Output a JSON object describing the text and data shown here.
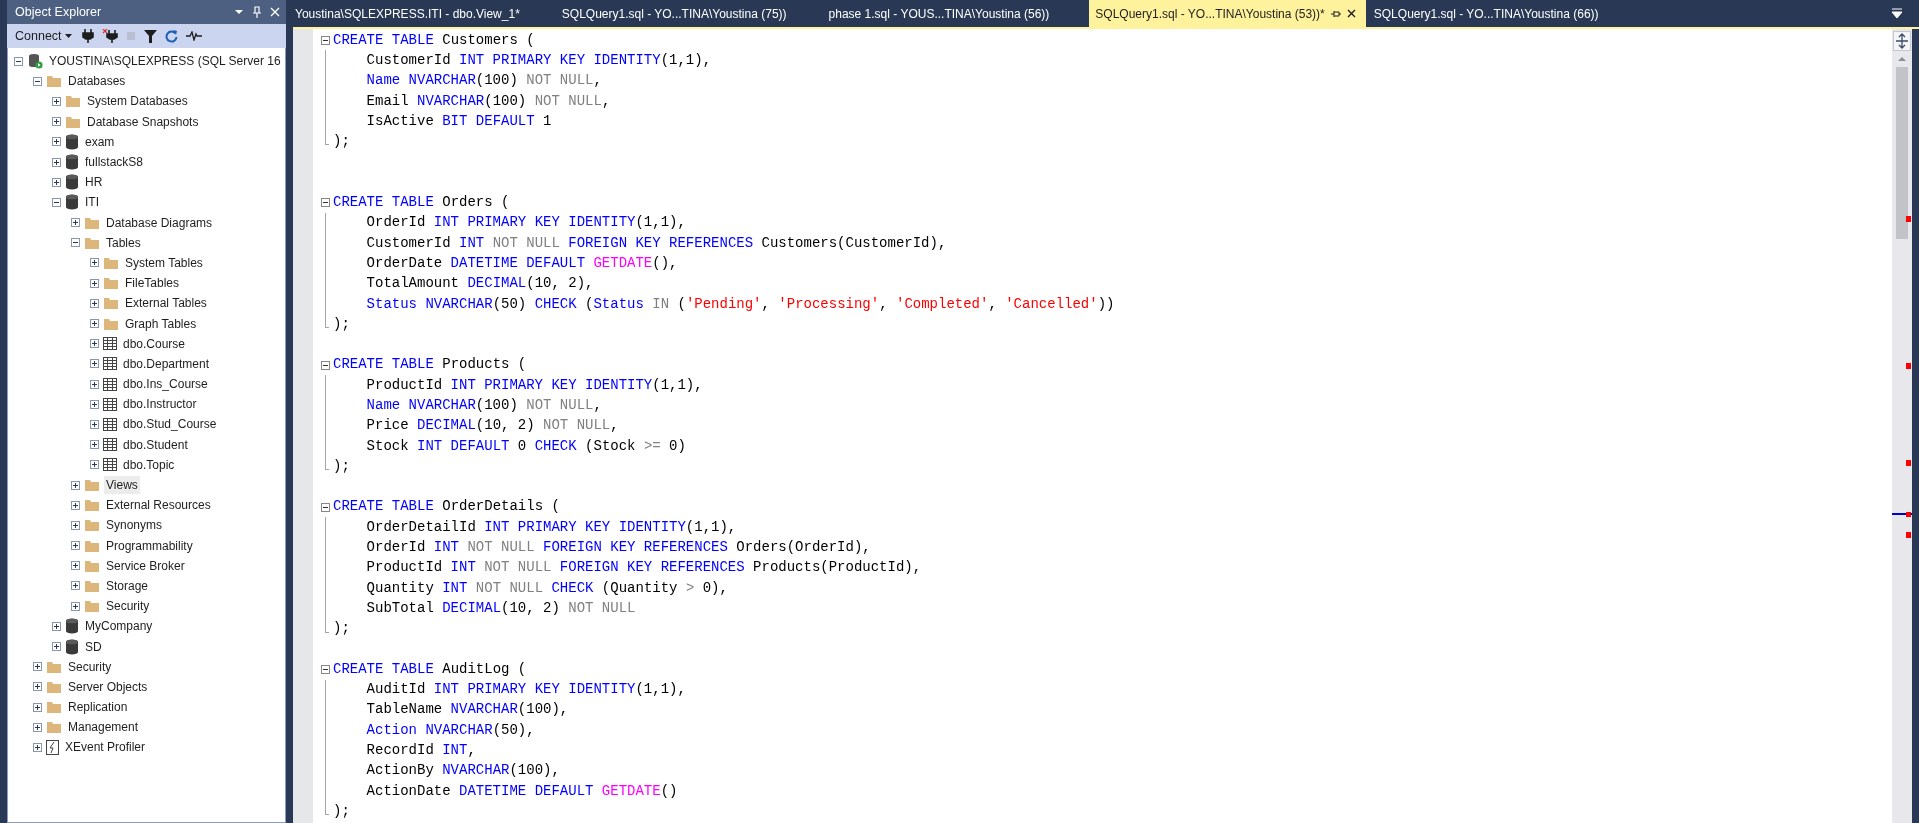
{
  "object_explorer": {
    "title": "Object Explorer",
    "toolbar": {
      "connect_label": "Connect"
    },
    "tree": [
      {
        "label": "YOUSTINA\\SQLEXPRESS (SQL Server 16",
        "kind": "server",
        "expanded": true,
        "selected": false,
        "children": [
          {
            "label": "Databases",
            "kind": "folder",
            "expanded": true,
            "selected": false,
            "children": [
              {
                "label": "System Databases",
                "kind": "folder",
                "expanded": false,
                "selected": false
              },
              {
                "label": "Database Snapshots",
                "kind": "folder",
                "expanded": false,
                "selected": false
              },
              {
                "label": "exam",
                "kind": "database",
                "expanded": false,
                "selected": false
              },
              {
                "label": "fullstackS8",
                "kind": "database",
                "expanded": false,
                "selected": false
              },
              {
                "label": "HR",
                "kind": "database",
                "expanded": false,
                "selected": false
              },
              {
                "label": "ITI",
                "kind": "database",
                "expanded": true,
                "selected": false,
                "children": [
                  {
                    "label": "Database Diagrams",
                    "kind": "folder",
                    "expanded": false,
                    "selected": false
                  },
                  {
                    "label": "Tables",
                    "kind": "folder",
                    "expanded": true,
                    "selected": false,
                    "children": [
                      {
                        "label": "System Tables",
                        "kind": "folder",
                        "expanded": false,
                        "selected": false
                      },
                      {
                        "label": "FileTables",
                        "kind": "folder",
                        "expanded": false,
                        "selected": false
                      },
                      {
                        "label": "External Tables",
                        "kind": "folder",
                        "expanded": false,
                        "selected": false
                      },
                      {
                        "label": "Graph Tables",
                        "kind": "folder",
                        "expanded": false,
                        "selected": false
                      },
                      {
                        "label": "dbo.Course",
                        "kind": "table",
                        "expanded": false,
                        "selected": false
                      },
                      {
                        "label": "dbo.Department",
                        "kind": "table",
                        "expanded": false,
                        "selected": false
                      },
                      {
                        "label": "dbo.Ins_Course",
                        "kind": "table",
                        "expanded": false,
                        "selected": false
                      },
                      {
                        "label": "dbo.Instructor",
                        "kind": "table",
                        "expanded": false,
                        "selected": false
                      },
                      {
                        "label": "dbo.Stud_Course",
                        "kind": "table",
                        "expanded": false,
                        "selected": false
                      },
                      {
                        "label": "dbo.Student",
                        "kind": "table",
                        "expanded": false,
                        "selected": false
                      },
                      {
                        "label": "dbo.Topic",
                        "kind": "table",
                        "expanded": false,
                        "selected": false
                      }
                    ]
                  },
                  {
                    "label": "Views",
                    "kind": "folder",
                    "expanded": false,
                    "selected": true
                  },
                  {
                    "label": "External Resources",
                    "kind": "folder",
                    "expanded": false,
                    "selected": false
                  },
                  {
                    "label": "Synonyms",
                    "kind": "folder",
                    "expanded": false,
                    "selected": false
                  },
                  {
                    "label": "Programmability",
                    "kind": "folder",
                    "expanded": false,
                    "selected": false
                  },
                  {
                    "label": "Service Broker",
                    "kind": "folder",
                    "expanded": false,
                    "selected": false
                  },
                  {
                    "label": "Storage",
                    "kind": "folder",
                    "expanded": false,
                    "selected": false
                  },
                  {
                    "label": "Security",
                    "kind": "folder",
                    "expanded": false,
                    "selected": false
                  }
                ]
              },
              {
                "label": "MyCompany",
                "kind": "database",
                "expanded": false,
                "selected": false
              },
              {
                "label": "SD",
                "kind": "database",
                "expanded": false,
                "selected": false
              }
            ]
          },
          {
            "label": "Security",
            "kind": "folder",
            "expanded": false,
            "selected": false
          },
          {
            "label": "Server Objects",
            "kind": "folder",
            "expanded": false,
            "selected": false
          },
          {
            "label": "Replication",
            "kind": "folder",
            "expanded": false,
            "selected": false
          },
          {
            "label": "Management",
            "kind": "folder",
            "expanded": false,
            "selected": false
          },
          {
            "label": "XEvent Profiler",
            "kind": "xevent",
            "expanded": false,
            "selected": false
          }
        ]
      }
    ]
  },
  "tabs": [
    {
      "label": "Youstina\\SQLEXPRESS.ITI - dbo.View_1*",
      "selected": false
    },
    {
      "label": "SQLQuery1.sql - YO...TINA\\Youstina (75))",
      "selected": false
    },
    {
      "label": "phase 1.sql - YOUS...TINA\\Youstina (56))",
      "selected": false
    },
    {
      "label": "SQLQuery1.sql - YO...TINA\\Youstina (53))*",
      "selected": true
    },
    {
      "label": "SQLQuery1.sql - YO...TINA\\Youstina (66))",
      "selected": false
    }
  ],
  "editor": {
    "lines": [
      {
        "kind": "block_start",
        "tokens": [
          {
            "kind": "keyword",
            "text": "CREATE TABLE"
          },
          {
            "kind": "plain",
            "text": " Customers ("
          }
        ]
      },
      {
        "kind": "body",
        "tokens": [
          {
            "kind": "plain",
            "text": "CustomerId "
          },
          {
            "kind": "keyword",
            "text": "INT PRIMARY KEY IDENTITY"
          },
          {
            "kind": "plain",
            "text": "(1,1),"
          }
        ]
      },
      {
        "kind": "body",
        "tokens": [
          {
            "kind": "keyword",
            "text": "Name NVARCHAR"
          },
          {
            "kind": "plain",
            "text": "(100) "
          },
          {
            "kind": "gray",
            "text": "NOT NULL"
          },
          {
            "kind": "plain",
            "text": ","
          }
        ]
      },
      {
        "kind": "body",
        "tokens": [
          {
            "kind": "plain",
            "text": "Email "
          },
          {
            "kind": "keyword",
            "text": "NVARCHAR"
          },
          {
            "kind": "plain",
            "text": "(100) "
          },
          {
            "kind": "gray",
            "text": "NOT NULL"
          },
          {
            "kind": "plain",
            "text": ","
          }
        ]
      },
      {
        "kind": "body",
        "tokens": [
          {
            "kind": "plain",
            "text": "IsActive "
          },
          {
            "kind": "keyword",
            "text": "BIT DEFAULT"
          },
          {
            "kind": "plain",
            "text": " 1"
          }
        ]
      },
      {
        "kind": "block_end",
        "tokens": [
          {
            "kind": "plain",
            "text": ");"
          }
        ]
      },
      {
        "kind": "blank"
      },
      {
        "kind": "blank"
      },
      {
        "kind": "block_start",
        "tokens": [
          {
            "kind": "keyword",
            "text": "CREATE TABLE"
          },
          {
            "kind": "plain",
            "text": " Orders ("
          }
        ]
      },
      {
        "kind": "body",
        "tokens": [
          {
            "kind": "plain",
            "text": "OrderId "
          },
          {
            "kind": "keyword",
            "text": "INT PRIMARY KEY IDENTITY"
          },
          {
            "kind": "plain",
            "text": "(1,1),"
          }
        ]
      },
      {
        "kind": "body",
        "tokens": [
          {
            "kind": "plain",
            "text": "CustomerId "
          },
          {
            "kind": "keyword",
            "text": "INT "
          },
          {
            "kind": "gray",
            "text": "NOT NULL "
          },
          {
            "kind": "keyword",
            "text": "FOREIGN KEY REFERENCES"
          },
          {
            "kind": "plain",
            "text": " Customers(CustomerId),"
          }
        ]
      },
      {
        "kind": "body",
        "tokens": [
          {
            "kind": "plain",
            "text": "OrderDate "
          },
          {
            "kind": "keyword",
            "text": "DATETIME DEFAULT "
          },
          {
            "kind": "function",
            "text": "GETDATE"
          },
          {
            "kind": "plain",
            "text": "(),"
          }
        ]
      },
      {
        "kind": "body",
        "tokens": [
          {
            "kind": "plain",
            "text": "TotalAmount "
          },
          {
            "kind": "keyword",
            "text": "DECIMAL"
          },
          {
            "kind": "plain",
            "text": "(10, 2),"
          }
        ]
      },
      {
        "kind": "body",
        "tokens": [
          {
            "kind": "keyword",
            "text": "Status NVARCHAR"
          },
          {
            "kind": "plain",
            "text": "(50) "
          },
          {
            "kind": "keyword",
            "text": "CHECK"
          },
          {
            "kind": "plain",
            "text": " ("
          },
          {
            "kind": "keyword",
            "text": "Status "
          },
          {
            "kind": "gray",
            "text": "IN"
          },
          {
            "kind": "plain",
            "text": " ("
          },
          {
            "kind": "string",
            "text": "'Pending'"
          },
          {
            "kind": "plain",
            "text": ", "
          },
          {
            "kind": "string",
            "text": "'Processing'"
          },
          {
            "kind": "plain",
            "text": ", "
          },
          {
            "kind": "string",
            "text": "'Completed'"
          },
          {
            "kind": "plain",
            "text": ", "
          },
          {
            "kind": "string",
            "text": "'Cancelled'"
          },
          {
            "kind": "plain",
            "text": "))"
          }
        ]
      },
      {
        "kind": "block_end",
        "tokens": [
          {
            "kind": "plain",
            "text": ");"
          }
        ]
      },
      {
        "kind": "blank"
      },
      {
        "kind": "block_start",
        "tokens": [
          {
            "kind": "keyword",
            "text": "CREATE TABLE"
          },
          {
            "kind": "plain",
            "text": " Products ("
          }
        ]
      },
      {
        "kind": "body",
        "tokens": [
          {
            "kind": "plain",
            "text": "ProductId "
          },
          {
            "kind": "keyword",
            "text": "INT PRIMARY KEY IDENTITY"
          },
          {
            "kind": "plain",
            "text": "(1,1),"
          }
        ]
      },
      {
        "kind": "body",
        "tokens": [
          {
            "kind": "keyword",
            "text": "Name NVARCHAR"
          },
          {
            "kind": "plain",
            "text": "(100) "
          },
          {
            "kind": "gray",
            "text": "NOT NULL"
          },
          {
            "kind": "plain",
            "text": ","
          }
        ]
      },
      {
        "kind": "body",
        "tokens": [
          {
            "kind": "plain",
            "text": "Price "
          },
          {
            "kind": "keyword",
            "text": "DECIMAL"
          },
          {
            "kind": "plain",
            "text": "(10, 2) "
          },
          {
            "kind": "gray",
            "text": "NOT NULL"
          },
          {
            "kind": "plain",
            "text": ","
          }
        ]
      },
      {
        "kind": "body",
        "tokens": [
          {
            "kind": "plain",
            "text": "Stock "
          },
          {
            "kind": "keyword",
            "text": "INT DEFAULT"
          },
          {
            "kind": "plain",
            "text": " 0 "
          },
          {
            "kind": "keyword",
            "text": "CHECK"
          },
          {
            "kind": "plain",
            "text": " (Stock "
          },
          {
            "kind": "gray",
            "text": ">="
          },
          {
            "kind": "plain",
            "text": " 0)"
          }
        ]
      },
      {
        "kind": "block_end",
        "tokens": [
          {
            "kind": "plain",
            "text": ");"
          }
        ]
      },
      {
        "kind": "blank"
      },
      {
        "kind": "block_start",
        "tokens": [
          {
            "kind": "keyword",
            "text": "CREATE TABLE"
          },
          {
            "kind": "plain",
            "text": " OrderDetails ("
          }
        ]
      },
      {
        "kind": "body",
        "tokens": [
          {
            "kind": "plain",
            "text": "OrderDetailId "
          },
          {
            "kind": "keyword",
            "text": "INT PRIMARY KEY IDENTITY"
          },
          {
            "kind": "plain",
            "text": "(1,1),"
          }
        ]
      },
      {
        "kind": "body",
        "tokens": [
          {
            "kind": "plain",
            "text": "OrderId "
          },
          {
            "kind": "keyword",
            "text": "INT "
          },
          {
            "kind": "gray",
            "text": "NOT NULL "
          },
          {
            "kind": "keyword",
            "text": "FOREIGN KEY REFERENCES"
          },
          {
            "kind": "plain",
            "text": " Orders(OrderId),"
          }
        ]
      },
      {
        "kind": "body",
        "tokens": [
          {
            "kind": "plain",
            "text": "ProductId "
          },
          {
            "kind": "keyword",
            "text": "INT "
          },
          {
            "kind": "gray",
            "text": "NOT NULL "
          },
          {
            "kind": "keyword",
            "text": "FOREIGN KEY REFERENCES"
          },
          {
            "kind": "plain",
            "text": " Products(ProductId),"
          }
        ]
      },
      {
        "kind": "body",
        "tokens": [
          {
            "kind": "plain",
            "text": "Quantity "
          },
          {
            "kind": "keyword",
            "text": "INT "
          },
          {
            "kind": "gray",
            "text": "NOT NULL "
          },
          {
            "kind": "keyword",
            "text": "CHECK"
          },
          {
            "kind": "plain",
            "text": " (Quantity "
          },
          {
            "kind": "gray",
            "text": ">"
          },
          {
            "kind": "plain",
            "text": " 0),"
          }
        ]
      },
      {
        "kind": "body",
        "tokens": [
          {
            "kind": "plain",
            "text": "SubTotal "
          },
          {
            "kind": "keyword",
            "text": "DECIMAL"
          },
          {
            "kind": "plain",
            "text": "(10, 2) "
          },
          {
            "kind": "gray",
            "text": "NOT NULL"
          }
        ]
      },
      {
        "kind": "block_end",
        "tokens": [
          {
            "kind": "plain",
            "text": ");"
          }
        ]
      },
      {
        "kind": "blank"
      },
      {
        "kind": "block_start",
        "tokens": [
          {
            "kind": "keyword",
            "text": "CREATE TABLE"
          },
          {
            "kind": "plain",
            "text": " AuditLog ("
          }
        ]
      },
      {
        "kind": "body",
        "tokens": [
          {
            "kind": "plain",
            "text": "AuditId "
          },
          {
            "kind": "keyword",
            "text": "INT PRIMARY KEY IDENTITY"
          },
          {
            "kind": "plain",
            "text": "(1,1),"
          }
        ]
      },
      {
        "kind": "body",
        "tokens": [
          {
            "kind": "plain",
            "text": "TableName "
          },
          {
            "kind": "keyword",
            "text": "NVARCHAR"
          },
          {
            "kind": "plain",
            "text": "(100),"
          }
        ]
      },
      {
        "kind": "body",
        "tokens": [
          {
            "kind": "keyword",
            "text": "Action NVARCHAR"
          },
          {
            "kind": "plain",
            "text": "(50),"
          }
        ]
      },
      {
        "kind": "body",
        "tokens": [
          {
            "kind": "plain",
            "text": "RecordId "
          },
          {
            "kind": "keyword",
            "text": "INT"
          },
          {
            "kind": "plain",
            "text": ","
          }
        ]
      },
      {
        "kind": "body",
        "tokens": [
          {
            "kind": "plain",
            "text": "ActionBy "
          },
          {
            "kind": "keyword",
            "text": "NVARCHAR"
          },
          {
            "kind": "plain",
            "text": "(100),"
          }
        ]
      },
      {
        "kind": "body",
        "tokens": [
          {
            "kind": "plain",
            "text": "ActionDate "
          },
          {
            "kind": "keyword",
            "text": "DATETIME DEFAULT "
          },
          {
            "kind": "function",
            "text": "GETDATE"
          },
          {
            "kind": "plain",
            "text": "()"
          }
        ]
      },
      {
        "kind": "block_end",
        "tokens": [
          {
            "kind": "plain",
            "text": ");"
          }
        ]
      }
    ]
  }
}
